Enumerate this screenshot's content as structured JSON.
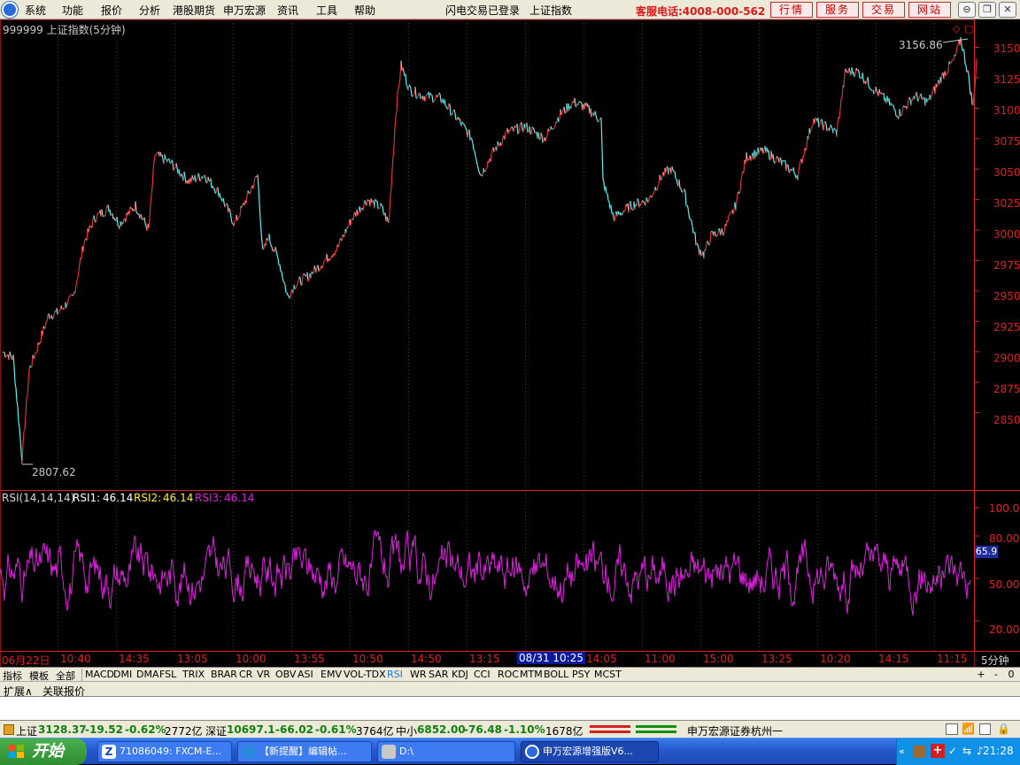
{
  "menu": {
    "items": [
      "系统",
      "功能",
      "报价",
      "分析",
      "港股期货",
      "申万宏源",
      "资讯",
      "工具",
      "帮助"
    ],
    "status_text": "闪电交易已登录",
    "index_name": "上证指数",
    "hotline": "客服电话:4008-000-562",
    "tabs": [
      "行情",
      "服务",
      "交易",
      "网站"
    ]
  },
  "chart": {
    "title": "999999 上证指数(5分钟)",
    "high_label": "3156.86",
    "low_label": "2807.62",
    "rsi_params": "RSI(14,14,14)",
    "rsi1_label": "RSI1:",
    "rsi1_value": "46.14",
    "rsi2_label": "RSI2:",
    "rsi2_value": "46.14",
    "rsi3_label": "RSI3:",
    "rsi3_value": "46.14",
    "rsi_current_box": "65.9",
    "period_label": "5分钟",
    "highlight_date": "08/31 10:25",
    "price_axis_labels": [
      "3150",
      "3125",
      "3100",
      "3075",
      "3050",
      "3025",
      "3000",
      "2975",
      "2950",
      "2925",
      "2900",
      "2875",
      "2850"
    ],
    "rsi_axis_labels": [
      "100.00",
      "80.00",
      "50.00",
      "20.00"
    ],
    "time_labels": [
      "06月22日",
      "10:40",
      "14:35",
      "13:05",
      "10:00",
      "13:55",
      "10:50",
      "14:50",
      "13:15",
      "14:05",
      "11:00",
      "15:00",
      "13:25",
      "10:20",
      "14:15",
      "11:15"
    ]
  },
  "chart_data": {
    "type": "line",
    "title": "999999 上证指数(5分钟)",
    "series": [
      {
        "name": "上证指数",
        "x_index": [
          0,
          12,
          22,
          30,
          40,
          52,
          62,
          80,
          92,
          104,
          120,
          132,
          150,
          165,
          172,
          190,
          210,
          228,
          245,
          262,
          275,
          288,
          294,
          300,
          312,
          322,
          330,
          345,
          360,
          378,
          395,
          412,
          428,
          436,
          444,
          450,
          460,
          475,
          495,
          515,
          530,
          540,
          555,
          570,
          590,
          612,
          630,
          645,
          660,
          676,
          678,
          690,
          710,
          730,
          745,
          755,
          770,
          785,
          792,
          800,
          815,
          828,
          840,
          860,
          880,
          898,
          915,
          930,
          942,
          952,
          966,
          985,
          1000,
          1012,
          1030,
          1045,
          1060,
          1075,
          1082,
          1090,
          1096,
          1100
        ],
        "values": [
          2900,
          2895,
          2812,
          2885,
          2905,
          2930,
          2932,
          2945,
          2990,
          3010,
          3018,
          3005,
          3020,
          3000,
          3062,
          3055,
          3040,
          3045,
          3030,
          3005,
          3025,
          3045,
          2980,
          2995,
          2975,
          2945,
          2955,
          2962,
          2972,
          2985,
          3010,
          3025,
          3018,
          3005,
          3095,
          3135,
          3115,
          3110,
          3108,
          3090,
          3075,
          3045,
          3065,
          3080,
          3085,
          3075,
          3095,
          3105,
          3100,
          3090,
          3040,
          3010,
          3020,
          3025,
          3045,
          3050,
          3030,
          2985,
          2980,
          2995,
          3000,
          3020,
          3060,
          3065,
          3055,
          3045,
          3090,
          3085,
          3080,
          3130,
          3130,
          3115,
          3105,
          3095,
          3110,
          3105,
          3125,
          3140,
          3156.86,
          3130,
          3100,
          3140
        ]
      }
    ],
    "ylim": [
      2807.62,
      3156.86
    ],
    "high": 3156.86,
    "low": 2807.62,
    "rsi": {
      "RSI1": 46.14,
      "RSI2": 46.14,
      "RSI3": 46.14,
      "current": 65.9,
      "ylim": [
        0,
        100
      ]
    }
  },
  "indicator_tabs": [
    "指标",
    "模板",
    "全部",
    "MACD",
    "DMI",
    "DMA",
    "FSL",
    "TRIX",
    "BRAR",
    "CR",
    "VR",
    "OBV",
    "ASI",
    "EMV",
    "VOL-TDX",
    "RSI",
    "WR",
    "SAR",
    "KDJ",
    "CCI",
    "ROC",
    "MTM",
    "BOLL",
    "PSY",
    "MCST"
  ],
  "indicator_active": "RSI",
  "indicator_controls": [
    "+",
    "-",
    "0"
  ],
  "sub_tabs": [
    "扩展∧",
    "关联报价"
  ],
  "status": {
    "sh_label": "上证",
    "sh_value": "3128.37",
    "sh_change": "-19.52",
    "sh_pct": "-0.62%",
    "sh_amount": "2772亿",
    "sz_label": "深证",
    "sz_value": "10697.1",
    "sz_change": "-66.02",
    "sz_pct": "-0.61%",
    "sz_amount": "3764亿",
    "zx_label": "中小",
    "zx_value": "6852.00",
    "zx_change": "-76.48",
    "zx_pct": "-1.10%",
    "zx_amount": "1678亿",
    "broker": "申万宏源证券杭州一"
  },
  "taskbar": {
    "start_label": "开始",
    "tasks": [
      "71086049: FXCM-E...",
      "【新提醒】编辑帖...",
      "D:\\",
      "申万宏源增强版V6..."
    ],
    "clock": "21:28"
  },
  "colors": {
    "up": "#e03030",
    "down": "#5cf0f0",
    "rsi": "#e020e0",
    "axis": "#e02020",
    "grid": "#8a1010"
  }
}
